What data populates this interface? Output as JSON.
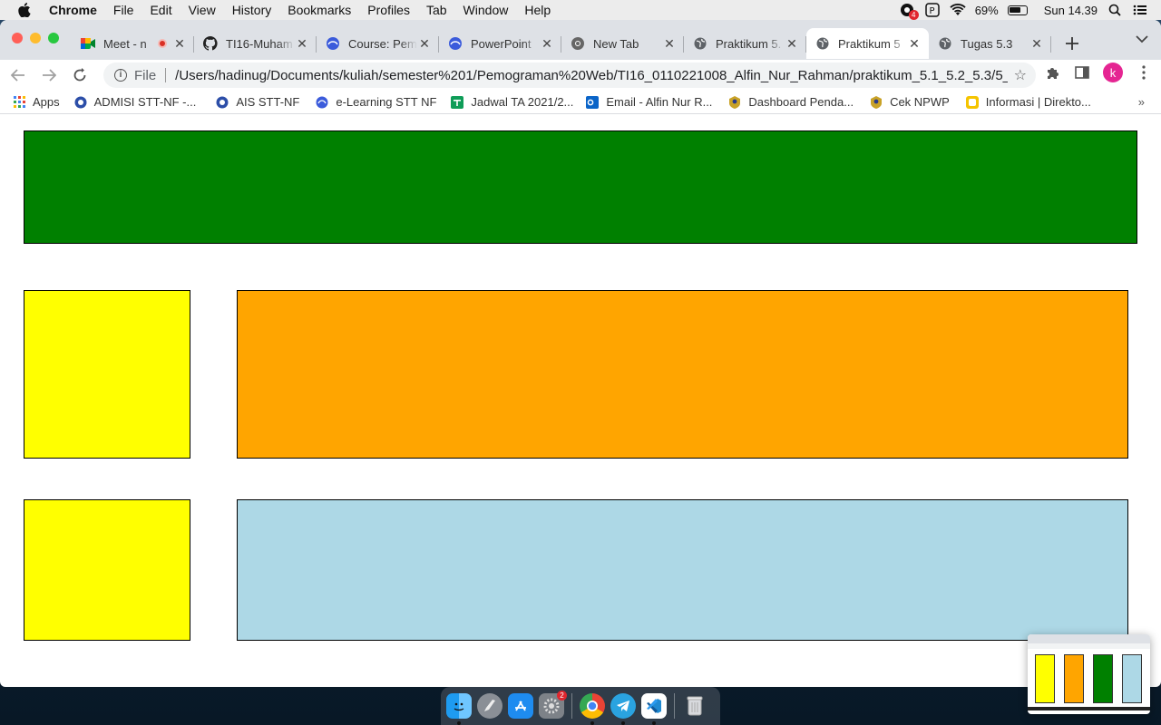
{
  "menubar": {
    "app_name": "Chrome",
    "items": [
      "File",
      "Edit",
      "View",
      "History",
      "Bookmarks",
      "Profiles",
      "Tab",
      "Window",
      "Help"
    ],
    "battery_percent": "69%",
    "clock": "Sun 14.39",
    "notification_badge": "4"
  },
  "tabs": [
    {
      "title": "Meet - n",
      "icon": "google-meet-icon",
      "recording": true
    },
    {
      "title": "TI16-Muham",
      "icon": "github-icon"
    },
    {
      "title": "Course: Pem",
      "icon": "moodle-icon"
    },
    {
      "title": "PowerPoint",
      "icon": "moodle-icon"
    },
    {
      "title": "New Tab",
      "icon": "chrome-icon"
    },
    {
      "title": "Praktikum 5.",
      "icon": "globe-icon"
    },
    {
      "title": "Praktikum 5",
      "icon": "globe-icon",
      "active": true
    },
    {
      "title": "Tugas 5.3",
      "icon": "globe-icon"
    }
  ],
  "toolbar": {
    "scheme_label": "File",
    "url": "/Users/hadinug/Documents/kuliah/semester%201/Pemograman%20Web/TI16_0110221008_Alfin_Nur_Rahman/praktikum_5.1_5.2_5.3/5_2....",
    "profile_initial": "k"
  },
  "bookmarks": [
    {
      "label": "Apps",
      "icon": "apps-grid-icon"
    },
    {
      "label": "ADMISI STT-NF -...",
      "icon": "sttnf-icon"
    },
    {
      "label": "AIS STT-NF",
      "icon": "sttnf-icon"
    },
    {
      "label": "e-Learning STT NF",
      "icon": "moodle-icon"
    },
    {
      "label": "Jadwal TA 2021/2...",
      "icon": "sheets-icon"
    },
    {
      "label": "Email - Alfin Nur R...",
      "icon": "outlook-icon"
    },
    {
      "label": "Dashboard Penda...",
      "icon": "emblem-icon"
    },
    {
      "label": "Cek NPWP",
      "icon": "emblem-icon"
    },
    {
      "label": "Informasi | Direkto...",
      "icon": "info-icon"
    }
  ],
  "colors": {
    "header_box": "#008000",
    "sidebar_box": "#ffff00",
    "main_box": "#ffa500",
    "footer_box": "#add8e6"
  },
  "dock": {
    "apps": [
      "finder-icon",
      "launchpad-icon",
      "app-store-icon",
      "system-preferences-icon",
      "chrome-icon",
      "telegram-icon",
      "vscode-icon",
      "trash-icon"
    ],
    "system_preferences_badge": "2"
  }
}
